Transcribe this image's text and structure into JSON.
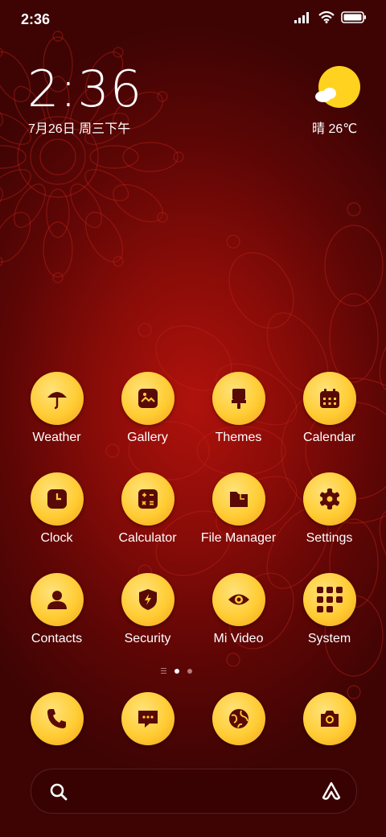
{
  "status_bar": {
    "time": "2:36",
    "icons": [
      "signal-icon",
      "wifi-icon",
      "battery-icon"
    ]
  },
  "clock_widget": {
    "time": "2:36",
    "date": "7月26日 周三下午"
  },
  "weather_widget": {
    "icon": "sun-cloud-icon",
    "text": "晴 26℃"
  },
  "apps": [
    {
      "label": "Weather",
      "icon": "umbrella-icon"
    },
    {
      "label": "Gallery",
      "icon": "image-icon"
    },
    {
      "label": "Themes",
      "icon": "paintbrush-icon"
    },
    {
      "label": "Calendar",
      "icon": "calendar-icon"
    },
    {
      "label": "Clock",
      "icon": "clock-icon"
    },
    {
      "label": "Calculator",
      "icon": "calculator-icon"
    },
    {
      "label": "File Manager",
      "icon": "folder-icon"
    },
    {
      "label": "Settings",
      "icon": "gear-icon"
    },
    {
      "label": "Contacts",
      "icon": "person-icon"
    },
    {
      "label": "Security",
      "icon": "shield-icon"
    },
    {
      "label": "Mi Video",
      "icon": "eye-icon"
    },
    {
      "label": "System",
      "icon": "folder-grid-icon"
    }
  ],
  "page_indicator": {
    "pages": 2,
    "current": 1
  },
  "dock": [
    {
      "icon": "phone-icon"
    },
    {
      "icon": "message-icon"
    },
    {
      "icon": "browser-icon"
    },
    {
      "icon": "camera-icon"
    }
  ],
  "search_bar": {
    "left_icon": "search-icon",
    "right_icon": "assistant-icon"
  },
  "colors": {
    "icon_bg": "#ffcc33",
    "glyph": "#5a0a06",
    "background": "#8a0c08"
  }
}
